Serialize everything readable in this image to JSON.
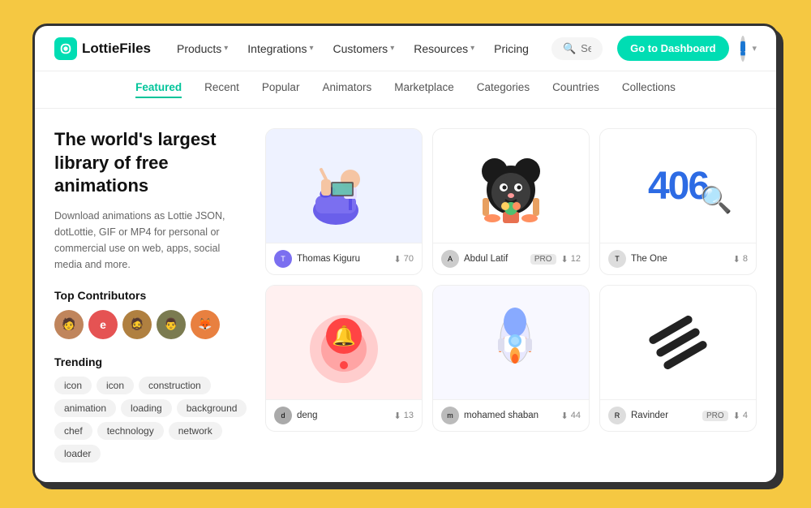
{
  "meta": {
    "bg_color": "#F5C842"
  },
  "navbar": {
    "logo_text": "LottieFiles",
    "nav_items": [
      {
        "label": "Products",
        "has_dropdown": true
      },
      {
        "label": "Integrations",
        "has_dropdown": true
      },
      {
        "label": "Customers",
        "has_dropdown": true
      },
      {
        "label": "Resources",
        "has_dropdown": true
      },
      {
        "label": "Pricing",
        "has_dropdown": false
      }
    ],
    "search_placeholder": "Search animations",
    "dashboard_btn": "Go to Dashboard"
  },
  "sub_nav": {
    "items": [
      {
        "label": "Featured",
        "active": true
      },
      {
        "label": "Recent",
        "active": false
      },
      {
        "label": "Popular",
        "active": false
      },
      {
        "label": "Animators",
        "active": false
      },
      {
        "label": "Marketplace",
        "active": false
      },
      {
        "label": "Categories",
        "active": false
      },
      {
        "label": "Countries",
        "active": false
      },
      {
        "label": "Collections",
        "active": false
      }
    ]
  },
  "hero": {
    "title": "The world's largest library of free animations",
    "description": "Download animations as Lottie JSON, dotLottie, GIF or MP4 for personal or commercial use on web, apps, social media and more."
  },
  "top_contributors": {
    "title": "Top Contributors",
    "avatars": [
      {
        "color": "#C0855C",
        "initials": "🧑"
      },
      {
        "color": "#E55353",
        "initials": "e"
      },
      {
        "color": "#B08040",
        "initials": "🧔"
      },
      {
        "color": "#7B7B50",
        "initials": "👨"
      },
      {
        "color": "#E88040",
        "initials": "🦊"
      }
    ]
  },
  "trending": {
    "title": "Trending",
    "tags": [
      "icon",
      "icon",
      "construction",
      "animation",
      "loading",
      "background",
      "chef",
      "technology",
      "network",
      "loader"
    ]
  },
  "cards": [
    {
      "thumb_style": "blue",
      "author": "Thomas Kiguru",
      "badge": null,
      "downloads": 70,
      "anim_type": "person"
    },
    {
      "thumb_style": "white",
      "author": "Abdul Latif",
      "badge": "PRO",
      "downloads": 12,
      "anim_type": "mouse"
    },
    {
      "thumb_style": "white",
      "author": "The One",
      "badge": null,
      "downloads": 8,
      "anim_type": "404"
    },
    {
      "thumb_style": "pink",
      "author": "deng",
      "badge": null,
      "downloads": 13,
      "anim_type": "alarm"
    },
    {
      "thumb_style": "light",
      "author": "mohamed shaban",
      "badge": null,
      "downloads": 44,
      "anim_type": "rocket"
    },
    {
      "thumb_style": "white",
      "author": "Ravinder",
      "badge": "PRO",
      "downloads": 4,
      "anim_type": "stripes"
    }
  ]
}
